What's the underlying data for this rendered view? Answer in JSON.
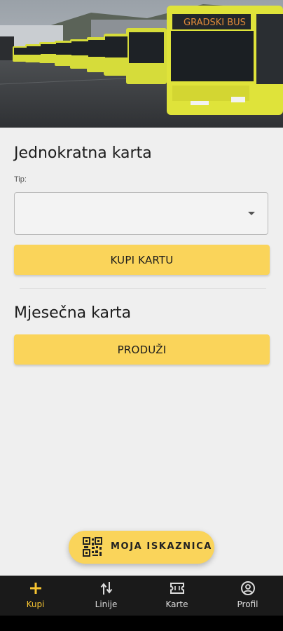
{
  "hero": {
    "image": "bus-depot-photo",
    "bus_sign_text": "GRADSKI BUS"
  },
  "single_ticket": {
    "title": "Jednokratna karta",
    "type_label": "Tip:",
    "type_value": "",
    "buy_button": "KUPI KARTU"
  },
  "monthly_ticket": {
    "title": "Mjesečna karta",
    "extend_button": "PRODUŽI"
  },
  "fab": {
    "label": "MOJA ISKAZNICA",
    "icon": "qr-code-icon"
  },
  "bottom_nav": {
    "items": [
      {
        "label": "Kupi",
        "icon": "plus-icon",
        "active": true
      },
      {
        "label": "Linije",
        "icon": "route-icon",
        "active": false
      },
      {
        "label": "Karte",
        "icon": "ticket-icon",
        "active": false
      },
      {
        "label": "Profil",
        "icon": "account-icon",
        "active": false
      }
    ]
  },
  "colors": {
    "accent": "#fad45a",
    "active_nav": "#f6c431",
    "nav_background": "#1a1a1a",
    "page_background": "#efefef"
  }
}
